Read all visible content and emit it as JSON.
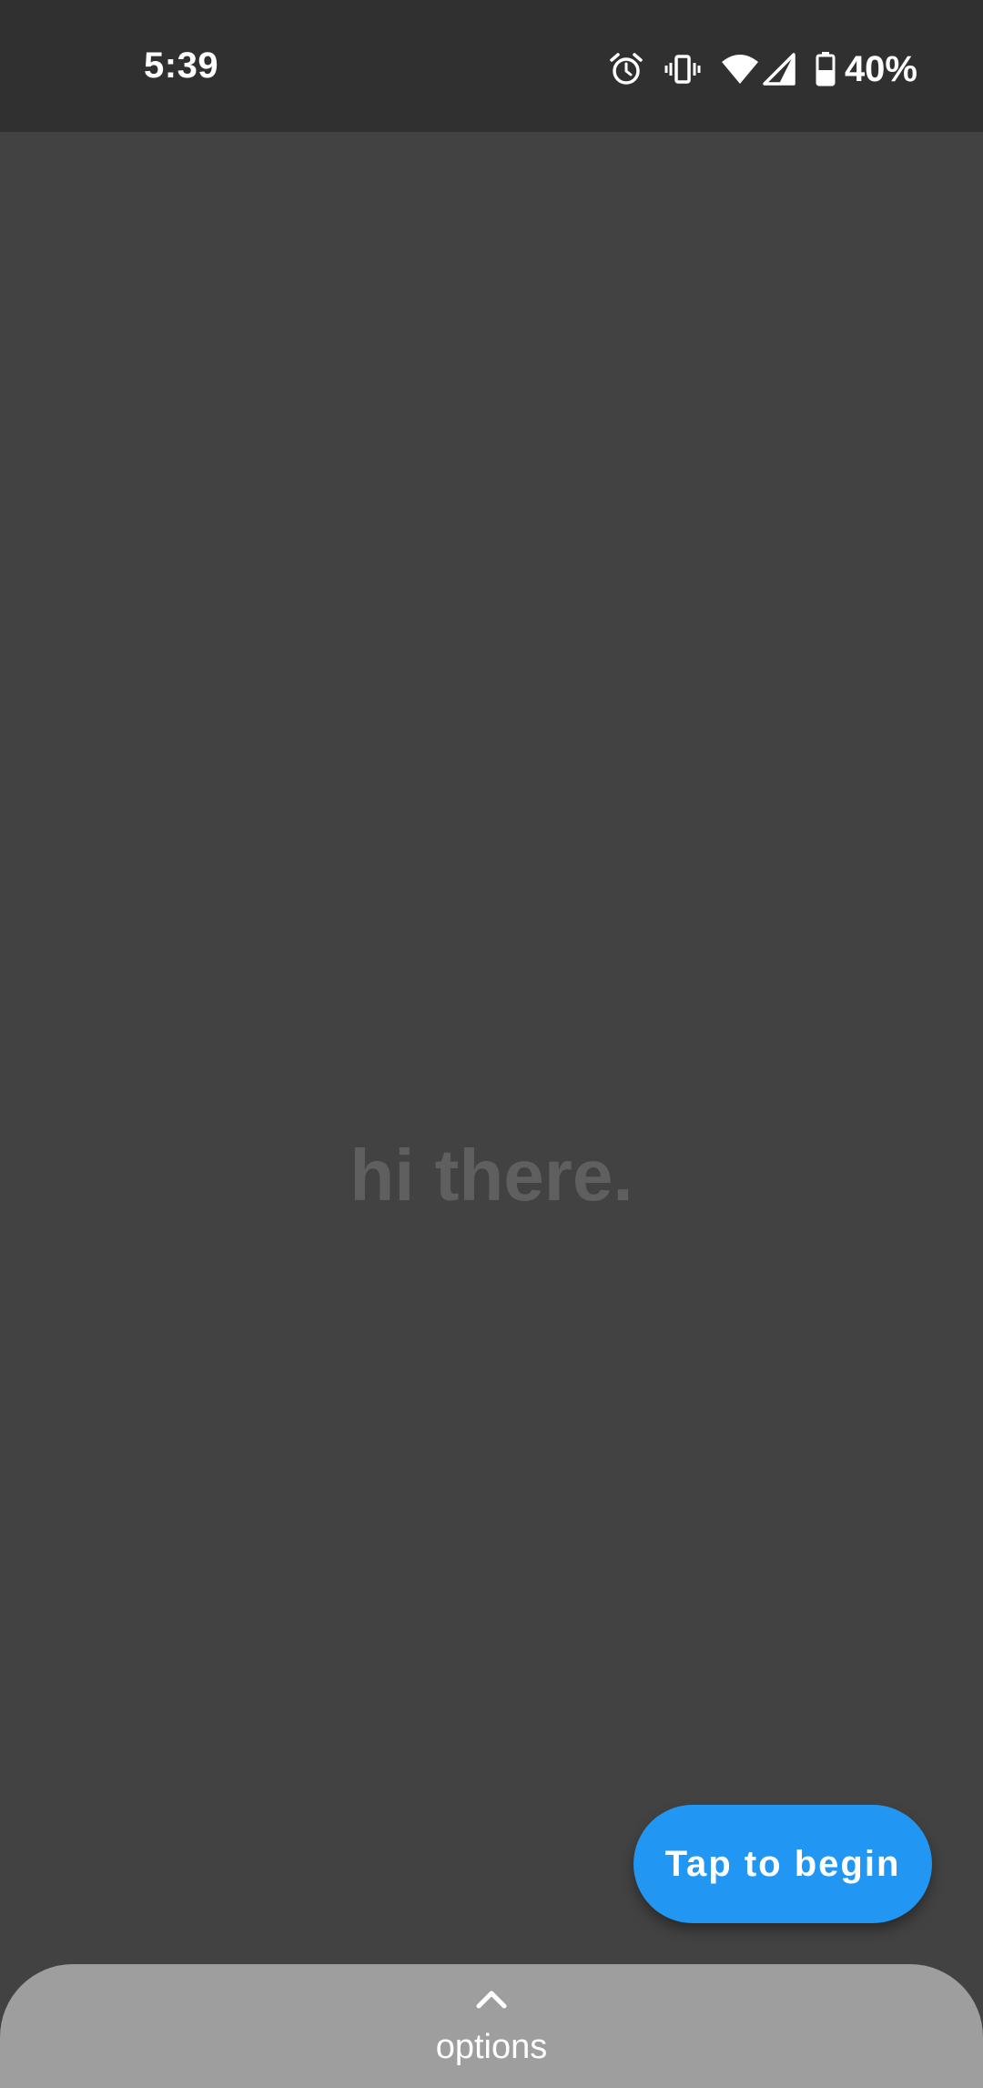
{
  "status_bar": {
    "time": "5:39",
    "battery_percent": "40%",
    "icons": [
      "alarm-icon",
      "vibrate-icon",
      "wifi-icon",
      "cell-signal-icon",
      "battery-icon"
    ]
  },
  "main": {
    "greeting": "hi there."
  },
  "fab": {
    "label": "Tap to begin",
    "color": "#2196f3"
  },
  "options_sheet": {
    "label": "options",
    "icon": "chevron-up-icon"
  },
  "colors": {
    "status_bar_bg": "#303030",
    "background": "#424242",
    "sheet_bg": "#9e9e9e",
    "greeting_text": "#5f5f5f"
  }
}
